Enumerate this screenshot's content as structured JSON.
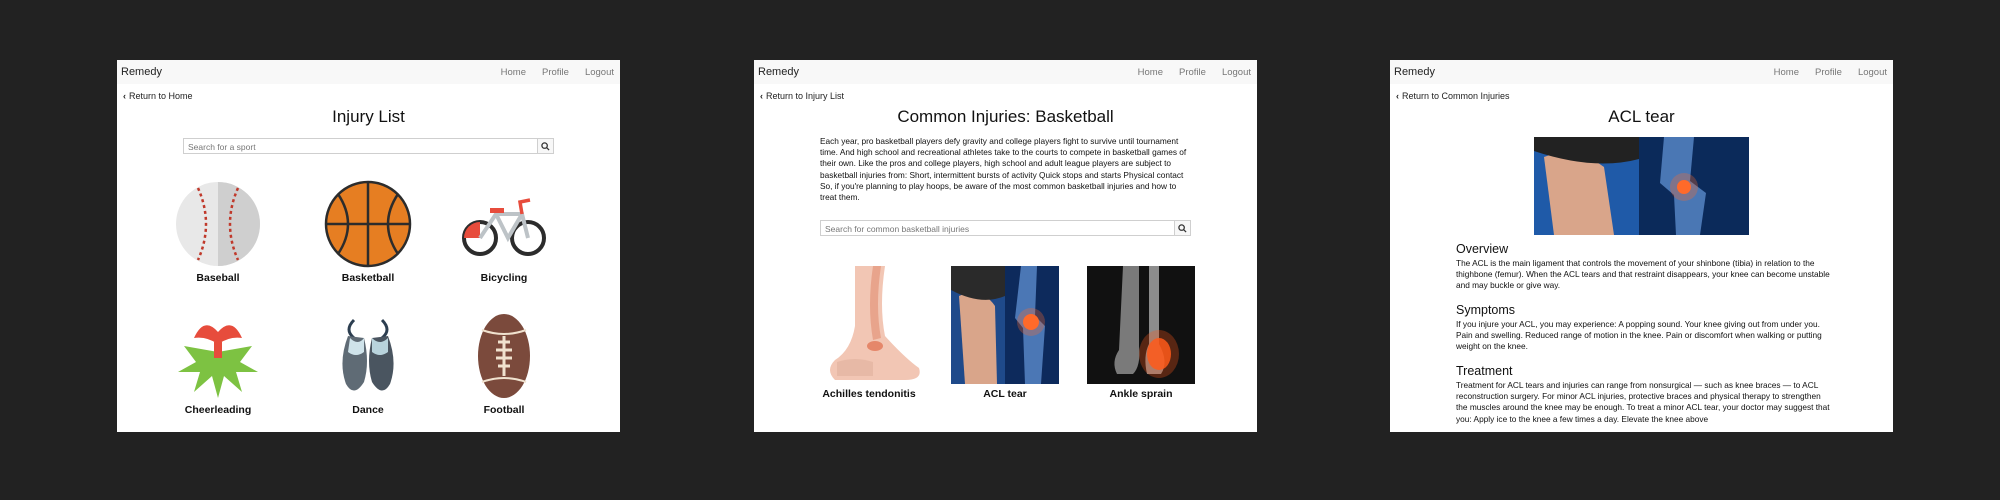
{
  "screens": [
    {
      "brand": "Remedy",
      "nav": [
        "Home",
        "Profile",
        "Logout"
      ],
      "back": "Return to Home",
      "title": "Injury List",
      "search_placeholder": "Search for a sport",
      "sports": [
        "Baseball",
        "Basketball",
        "Bicycling",
        "Cheerleading",
        "Dance",
        "Football"
      ]
    },
    {
      "brand": "Remedy",
      "nav": [
        "Home",
        "Profile",
        "Logout"
      ],
      "back": "Return to Injury List",
      "title": "Common Injuries: Basketball",
      "intro": "Each year, pro basketball players defy gravity and college players fight to survive until tournament time. And high school and recreational athletes take to the courts to compete in basketball games of their own. Like the pros and college players, high school and adult league players are subject to basketball injuries from: Short, intermittent bursts of activity Quick stops and starts Physical contact So, if you're planning to play hoops, be aware of the most common basketball injuries and how to treat them.",
      "search_placeholder": "Search for common basketball injuries",
      "injuries": [
        "Achilles tendonitis",
        "ACL tear",
        "Ankle sprain"
      ]
    },
    {
      "brand": "Remedy",
      "nav": [
        "Home",
        "Profile",
        "Logout"
      ],
      "back": "Return to Common Injuries",
      "title": "ACL tear",
      "sections": [
        {
          "heading": "Overview",
          "text": "The ACL is the main ligament that controls the movement of your shinbone (tibia) in relation to the thighbone (femur). When the ACL tears and that restraint disappears, your knee can become unstable and may buckle or give way."
        },
        {
          "heading": "Symptoms",
          "text": "If you injure your ACL, you may experience: A popping sound. Your knee giving out from under you. Pain and swelling. Reduced range of motion in the knee. Pain or discomfort when walking or putting weight on the knee."
        },
        {
          "heading": "Treatment",
          "text": "Treatment for ACL tears and injuries can range from nonsurgical — such as knee braces — to ACL reconstruction surgery. For minor ACL injuries, protective braces and physical therapy to strengthen the muscles around the knee may be enough. To treat a minor ACL tear, your doctor may suggest that you: Apply ice to the knee a few times a day. Elevate the knee above"
        }
      ]
    }
  ],
  "colors": {
    "background": "#222222",
    "navbar": "#f8f8f8",
    "screen": "#ffffff"
  }
}
